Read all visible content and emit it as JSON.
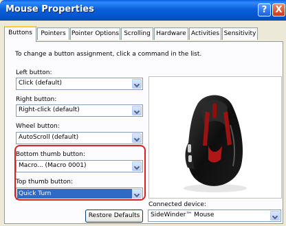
{
  "window": {
    "title": "Mouse Properties",
    "help_label": "?",
    "close_label": "X"
  },
  "tabs": [
    {
      "label": "Buttons"
    },
    {
      "label": "Pointers"
    },
    {
      "label": "Pointer Options"
    },
    {
      "label": "Scrolling"
    },
    {
      "label": "Hardware"
    },
    {
      "label": "Activities"
    },
    {
      "label": "Sensitivity"
    }
  ],
  "panel": {
    "instruction": "To change a button assignment, click a command in the list.",
    "left_button": {
      "label": "Left button:",
      "value": "Click (default)"
    },
    "right_button": {
      "label": "Right button:",
      "value": "Right-click (default)"
    },
    "wheel_button": {
      "label": "Wheel button:",
      "value": "AutoScroll (default)"
    },
    "bottom_thumb": {
      "label": "Bottom thumb button:",
      "value": "Macro... (Macro 0001)"
    },
    "top_thumb": {
      "label": "Top thumb button:",
      "value": "Quick Turn"
    },
    "restore_label": "Restore Defaults",
    "connected_label": "Connected device:",
    "connected_value": "SideWinder™ Mouse"
  },
  "colors": {
    "highlight_border": "#d8201e",
    "selection": "#316ac5",
    "titlebar": "#0a5fd8"
  }
}
